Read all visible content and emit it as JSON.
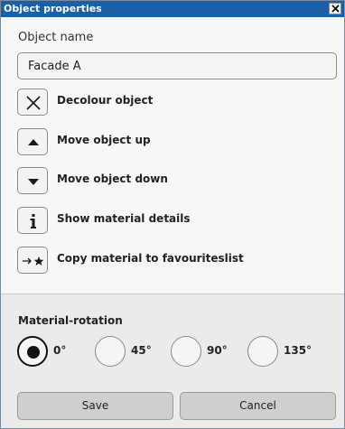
{
  "window": {
    "title": "Object properties",
    "close_glyph": "✕"
  },
  "object_name": {
    "label": "Object name",
    "value": "Facade A"
  },
  "actions": [
    {
      "label": "Decolour object",
      "icon": "x-icon"
    },
    {
      "label": "Move object up",
      "icon": "triangle-up-icon"
    },
    {
      "label": "Move object down",
      "icon": "triangle-down-icon"
    },
    {
      "label": "Show material details",
      "icon": "info-icon"
    },
    {
      "label": "Copy material to favouriteslist",
      "icon": "arrow-star-icon"
    }
  ],
  "rotation": {
    "label": "Material-rotation",
    "options": [
      {
        "label": "0°",
        "selected": true
      },
      {
        "label": "45°",
        "selected": false
      },
      {
        "label": "90°",
        "selected": false
      },
      {
        "label": "135°",
        "selected": false
      }
    ]
  },
  "buttons": {
    "save": "Save",
    "cancel": "Cancel"
  },
  "colors": {
    "titlebar": "#1a5fa8",
    "panel": "#f7f7f7",
    "lower_panel": "#ebebeb",
    "button": "#cfcfcf"
  }
}
